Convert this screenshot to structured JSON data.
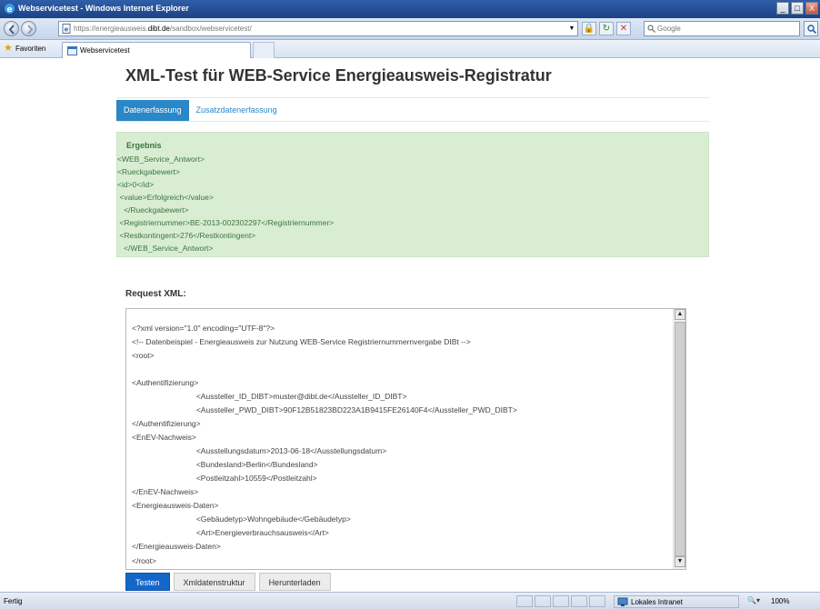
{
  "window": {
    "title": "Webservicetest - Windows Internet Explorer",
    "minimize_glyph": "_",
    "maximize_glyph": "□",
    "close_glyph": "X"
  },
  "navbar": {
    "url_prefix": "https://energieausweis.",
    "url_domain": "dibt.de",
    "url_path": "/sandbox/webservicetest/",
    "search_placeholder": "Google"
  },
  "favorites": {
    "label": "Favoriten",
    "tab_title": "Webservicetest"
  },
  "page": {
    "heading": "XML-Test für WEB-Service Energieausweis-Registratur",
    "tabs": [
      {
        "label": "Datenerfassung",
        "active": true
      },
      {
        "label": "Zusatzdatenerfassung",
        "active": false
      }
    ],
    "result": {
      "title": "Ergebnis",
      "lines": [
        "<WEB_Service_Antwort>",
        "<Rueckgabewert>",
        "<id>0</id>",
        " <value>Erfolgreich</value>",
        "   </Rueckgabewert>",
        " <Registriernummer>BE-2013-002302297</Registriernummer>",
        " <Restkontingent>276</Restkontingent>",
        "   </WEB_Service_Antwort>"
      ]
    },
    "request_label": "Request XML:",
    "request_lines": [
      "<?xml version=\"1.0\" encoding=\"UTF-8\"?>",
      "<!-- Datenbeispiel - Energieausweis zur Nutzung WEB-Service Registriernummernvergabe DIBt -->",
      "<root>",
      "",
      "<Authentifizierung>",
      "                              <Aussteller_ID_DIBT>muster@dibt.de</Aussteller_ID_DIBT>",
      "                              <Aussteller_PWD_DIBT>90F12B51823BD223A1B9415FE26140F4</Aussteller_PWD_DIBT>",
      "</Authentifizierung>",
      "<EnEV-Nachweis>",
      "                              <Ausstellungsdatum>2013-06-18</Ausstellungsdatum>",
      "                              <Bundesland>Berlin</Bundesland>",
      "                              <Postleitzahl>10559</Postleitzahl>",
      "</EnEV-Nachweis>",
      "<Energieausweis-Daten>",
      "                              <Gebäudetyp>Wohngebäude</Gebäudetyp>",
      "                              <Art>Energieverbrauchsausweis</Art>",
      "</Energieausweis-Daten>",
      "",
      "</root>"
    ],
    "buttons": {
      "test": "Testen",
      "structure": "Xmldatenstruktur",
      "download": "Herunterladen"
    }
  },
  "statusbar": {
    "left": "Fertig",
    "zone": "Lokales Intranet",
    "zoom": "100%"
  },
  "colors": {
    "accent": "#2a87c8",
    "primary_button": "#1466c8",
    "result_bg": "#d9edd3",
    "result_text": "#3c763d"
  }
}
